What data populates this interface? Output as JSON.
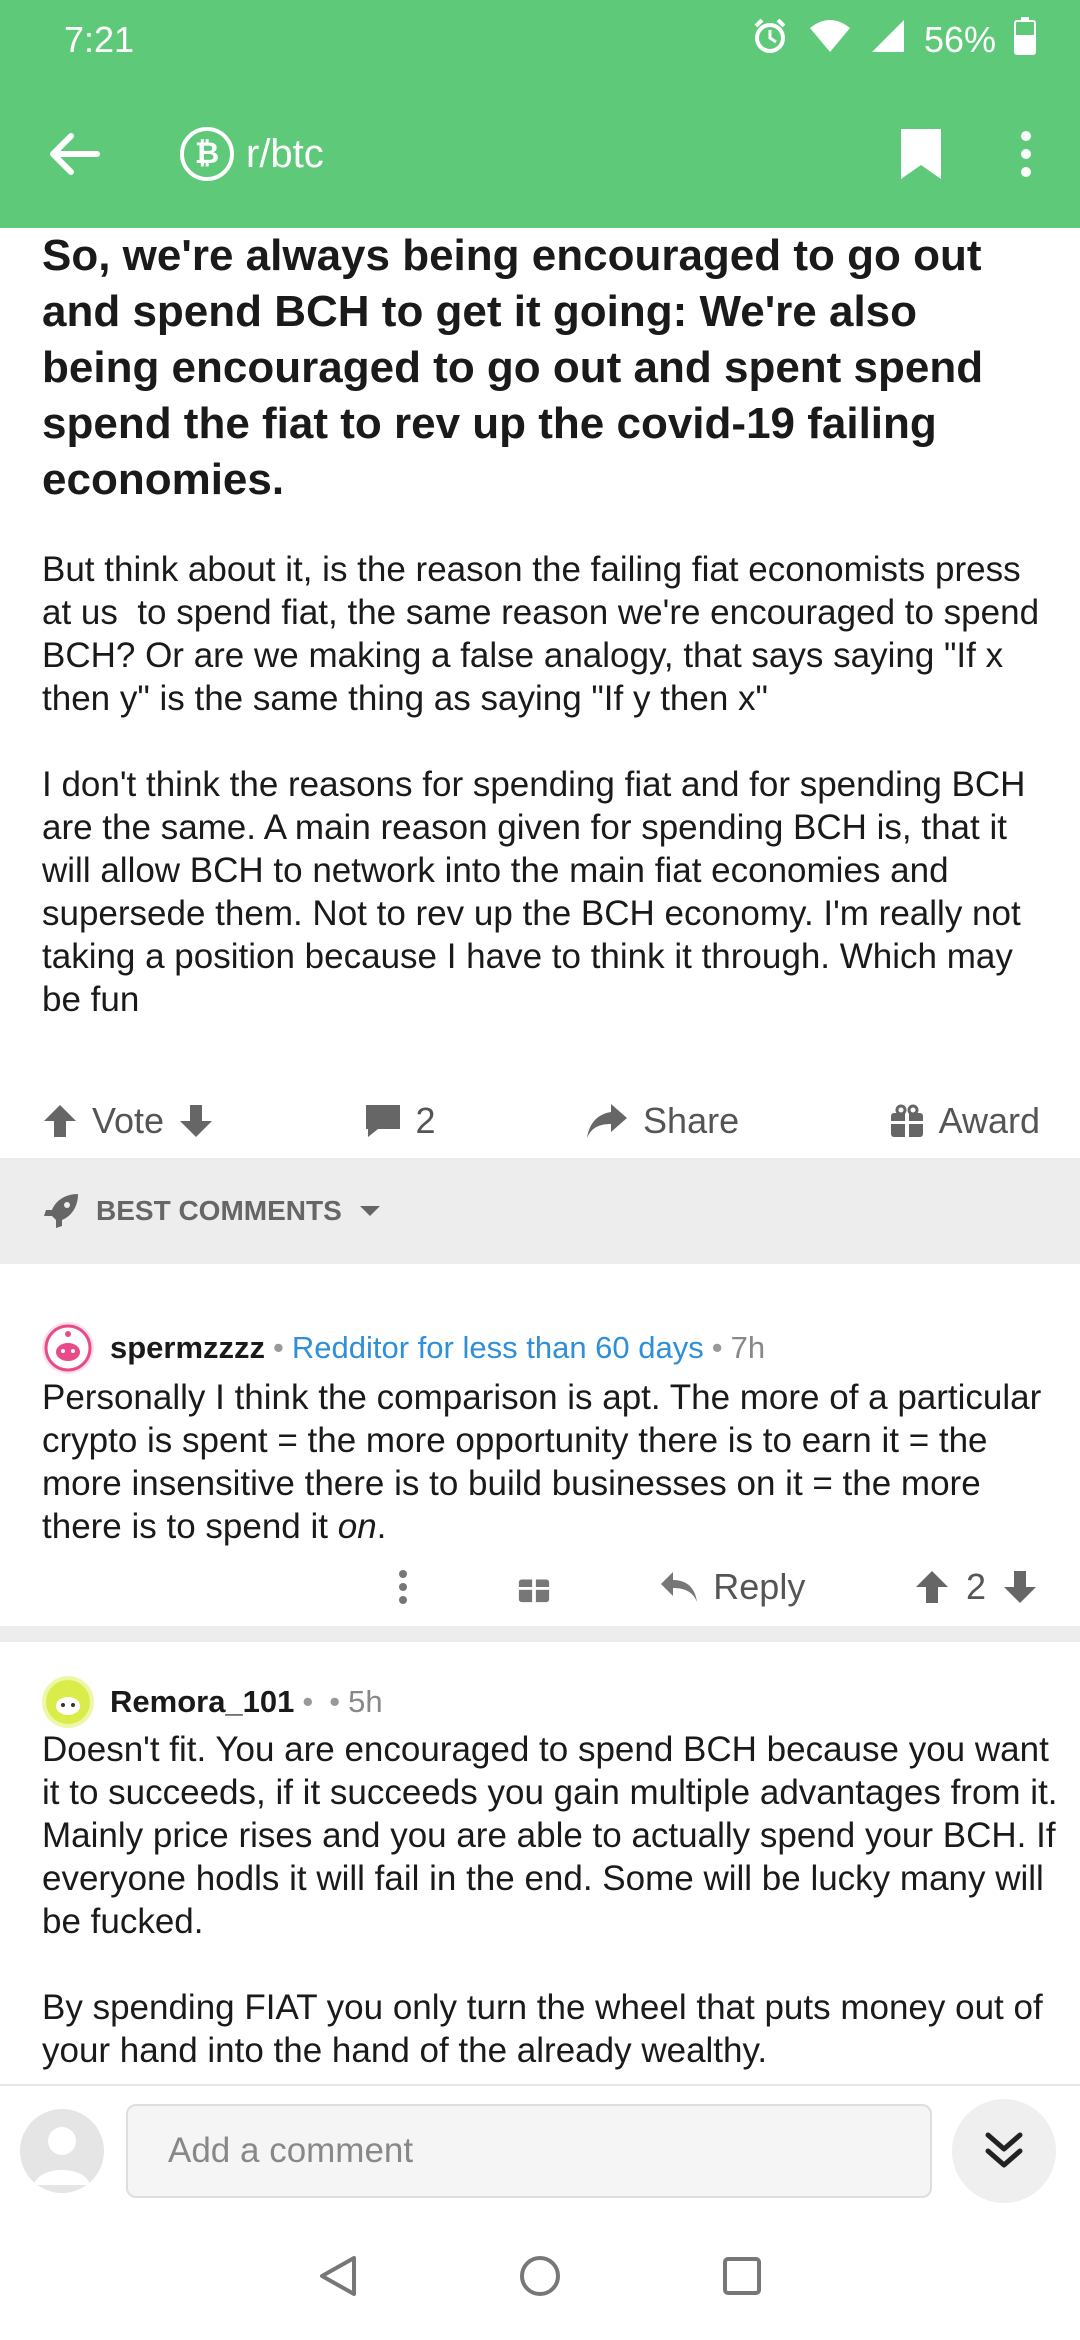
{
  "status_bar": {
    "time": "7:21",
    "battery": "56%"
  },
  "app_bar": {
    "subreddit": "r/btc"
  },
  "post": {
    "title": "So, we're always being encouraged to go out and spend BCH to get it going: We're also being encouraged to go out and spent spend spend the fiat to rev up the covid-19 failing economies.",
    "body": [
      "But think about it, is the reason the failing fiat economists press at us  to spend fiat, the same reason we're encouraged to spend BCH? Or are we making a false analogy, that says saying \"If x then y\" is the same thing as saying \"If y then x\"",
      "I don't think the reasons for spending fiat and for spending BCH are the same. A main reason given for spending BCH is, that it will allow BCH to network into the main fiat economies and  supersede them. Not to rev up the BCH economy. I'm really not taking a position because I have to think it through. Which may be fun"
    ],
    "actions": {
      "vote_label": "Vote",
      "comments_count": "2",
      "share_label": "Share",
      "award_label": "Award"
    }
  },
  "sort": {
    "label": "BEST COMMENTS"
  },
  "comments": [
    {
      "user": "spermzzzz",
      "flair": "Redditor for less than 60 days",
      "time": "7h",
      "body_main": "Personally I think the comparison is apt.  The more of a particular crypto is spent = the more opportunity there is to earn it = the more insensitive there is to build businesses on it = the more there is to spend it ",
      "body_emph": "on",
      "body_end": ".",
      "reply_label": "Reply",
      "score": "2"
    },
    {
      "user": "Remora_101",
      "flair_sep": "•",
      "time": "5h",
      "body": [
        "Doesn't fit.  You are encouraged to spend BCH because you want it to succeeds, if it succeeds you gain multiple advantages from it. Mainly price rises and you are able to actually spend your BCH. If everyone hodls it will fail in the end. Some will be lucky many will be fucked.",
        "By spending FIAT you only turn the wheel that puts money out of your hand into the hand of the already wealthy."
      ]
    }
  ],
  "bottom_bar": {
    "placeholder": "Add a comment"
  },
  "colors": {
    "header": "#5fc97a",
    "flair": "#2f8fd8"
  }
}
